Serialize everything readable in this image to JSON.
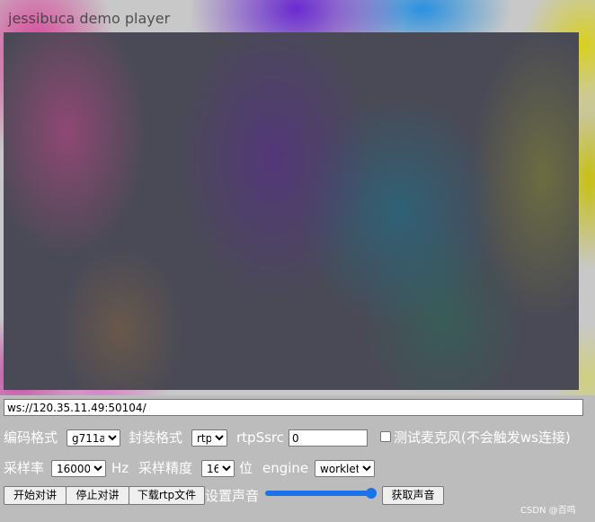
{
  "player": {
    "title": "jessibuca demo player"
  },
  "connection": {
    "url": "ws://120.35.11.49:50104/"
  },
  "row1": {
    "encode_label": "编码格式",
    "encode_value": "g711a",
    "package_label": "封装格式",
    "package_value": "rtp",
    "ssrc_label": "rtpSsrc",
    "ssrc_value": "0",
    "mic_test_label": "测试麦克风(不会触发ws连接)"
  },
  "row2": {
    "rate_label": "采样率",
    "rate_value": "16000",
    "rate_unit": "Hz",
    "precision_label": "采样精度",
    "precision_value": "16",
    "precision_unit": "位",
    "engine_label": "engine",
    "engine_value": "worklet"
  },
  "row3": {
    "start_talk": "开始对讲",
    "stop_talk": "停止对讲",
    "download_rtp": "下载rtp文件",
    "volume_label": "设置声音",
    "volume_level": 1.0,
    "get_sound": "获取声音"
  },
  "watermark": "CSDN @百鸣",
  "colors": {
    "slider": "#1a73e8",
    "panel": "#bdbdbd",
    "text": "#ffffff"
  }
}
